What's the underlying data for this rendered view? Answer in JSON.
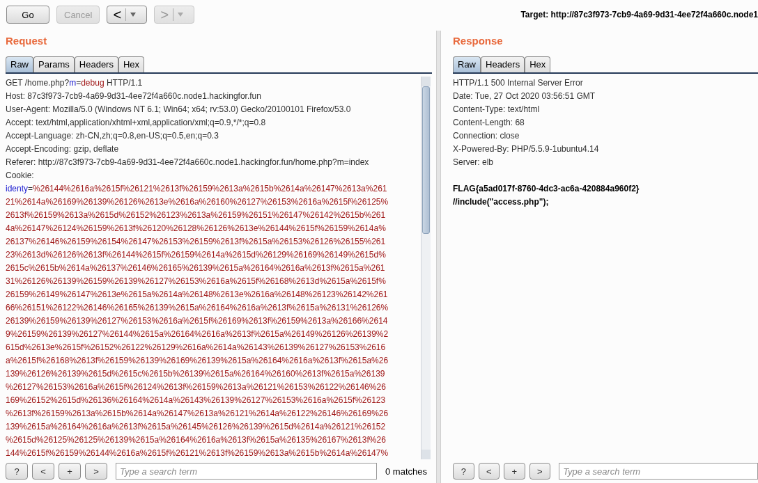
{
  "toolbar": {
    "buttons": [
      {
        "label": "Go",
        "disabled": false
      },
      {
        "label": "Cancel",
        "disabled": true
      }
    ],
    "nav": [
      {
        "label": "<",
        "disabled": false
      },
      {
        "label": ">",
        "disabled": true
      }
    ],
    "target": "Target: http://87c3f973-7cb9-4a69-9d31-4ee72f4a660c.node1"
  },
  "request": {
    "title": "Request",
    "tabs": [
      {
        "label": "Raw",
        "selected": true
      },
      {
        "label": "Params",
        "selected": false
      },
      {
        "label": "Headers",
        "selected": false
      },
      {
        "label": "Hex",
        "selected": false
      }
    ],
    "lines": [
      [
        {
          "text": "GET /home.php?",
          "kind": "plain"
        },
        {
          "text": "m",
          "kind": "key"
        },
        {
          "text": "=",
          "kind": "plain"
        },
        {
          "text": "debug",
          "kind": "value"
        },
        {
          "text": " HTTP/1.1",
          "kind": "plain"
        }
      ],
      [
        {
          "text": "Host: 87c3f973-7cb9-4a69-9d31-4ee72f4a660c.node1.hackingfor.fun",
          "kind": "plain"
        }
      ],
      [
        {
          "text": "User-Agent: Mozilla/5.0 (Windows NT 6.1; Win64; x64; rv:53.0) Gecko/20100101 Firefox/53.0",
          "kind": "plain"
        }
      ],
      [
        {
          "text": "Accept: text/html,application/xhtml+xml,application/xml;q=0.9,*/*;q=0.8",
          "kind": "plain"
        }
      ],
      [
        {
          "text": "Accept-Language: zh-CN,zh;q=0.8,en-US;q=0.5,en;q=0.3",
          "kind": "plain"
        }
      ],
      [
        {
          "text": "Accept-Encoding: gzip, deflate",
          "kind": "plain"
        }
      ],
      [
        {
          "text": "Referer: http://87c3f973-7cb9-4a69-9d31-4ee72f4a660c.node1.hackingfor.fun/home.php?m=index",
          "kind": "plain"
        }
      ],
      [
        {
          "text": "Cookie:",
          "kind": "plain"
        }
      ],
      [
        {
          "text": "identy",
          "kind": "key"
        },
        {
          "text": "=",
          "kind": "plain"
        },
        {
          "text": "%26144%2616a%2615f%26121%2613f%26159%2613a%2615b%2614a%26147%2613a%261",
          "kind": "value"
        }
      ],
      [
        {
          "text": "21%2614a%26169%26139%26126%2613e%2616a%26160%26127%26153%2616a%2615f%26125%",
          "kind": "value"
        }
      ],
      [
        {
          "text": "2613f%26159%2613a%2615d%26152%26123%2613a%26159%26151%26147%26142%2615b%261",
          "kind": "value"
        }
      ],
      [
        {
          "text": "4a%26147%26124%26159%2613f%26120%26128%26126%2613e%26144%2615f%26159%2614a%",
          "kind": "value"
        }
      ],
      [
        {
          "text": "26137%26146%26159%26154%26147%26153%26159%2613f%2615a%26153%26126%26155%261",
          "kind": "value"
        }
      ],
      [
        {
          "text": "23%2613d%26126%2613f%26144%2615f%26159%2614a%2615d%26129%26169%26149%2615d%",
          "kind": "value"
        }
      ],
      [
        {
          "text": "2615c%2615b%2614a%26137%26146%26165%26139%2615a%26164%2616a%2613f%2615a%261",
          "kind": "value"
        }
      ],
      [
        {
          "text": "31%26126%26139%26159%26139%26127%26153%2616a%2615f%26168%2613d%2615a%2615f%",
          "kind": "value"
        }
      ],
      [
        {
          "text": "26159%26149%26147%2613e%2615a%2614a%26148%2613e%2616a%26148%26123%26142%261",
          "kind": "value"
        }
      ],
      [
        {
          "text": "66%26151%26122%26146%26165%26139%2615a%26164%2616a%2613f%2615a%26131%26126%",
          "kind": "value"
        }
      ],
      [
        {
          "text": "26139%26159%26139%26127%26153%2616a%2615f%26169%2613f%26159%2613a%26166%2614",
          "kind": "value"
        }
      ],
      [
        {
          "text": "9%26159%26139%26127%26144%2615a%26164%2616a%2613f%2615a%26149%26126%26139%2",
          "kind": "value"
        }
      ],
      [
        {
          "text": "615d%2613e%2615f%26152%26122%26129%2616a%2614a%26143%26139%26127%26153%2616",
          "kind": "value"
        }
      ],
      [
        {
          "text": "a%2615f%26168%2613f%26159%26139%26169%26139%2615a%26164%2616a%2613f%2615a%26",
          "kind": "value"
        }
      ],
      [
        {
          "text": "139%26126%26139%2615d%2615c%2615b%26139%2615a%26164%26160%2613f%2615a%26139",
          "kind": "value"
        }
      ],
      [
        {
          "text": "%26127%26153%2616a%2615f%26124%2613f%26159%2613a%26121%26153%26122%26146%26",
          "kind": "value"
        }
      ],
      [
        {
          "text": "169%26152%2615d%26136%26164%2614a%26143%26139%26127%26153%2616a%2615f%26123",
          "kind": "value"
        }
      ],
      [
        {
          "text": "%2613f%26159%2613a%2615b%2614a%26147%2613a%26121%2614a%26122%26146%26169%26",
          "kind": "value"
        }
      ],
      [
        {
          "text": "139%2615a%26164%2616a%2613f%2615a%26145%26126%26139%2615d%2614a%26121%26152",
          "kind": "value"
        }
      ],
      [
        {
          "text": "%2615d%26125%26125%26139%2615a%26164%2616a%2613f%2615a%26135%26167%2613f%26",
          "kind": "value"
        }
      ],
      [
        {
          "text": "144%2615f%26159%26144%2616a%2615f%26121%2613f%26159%2613a%2615b%2614a%26147%",
          "kind": "value"
        }
      ]
    ],
    "search": {
      "buttons": [
        "?",
        "<",
        "+",
        ">"
      ],
      "placeholder": "Type a search term",
      "matches": "0 matches"
    }
  },
  "response": {
    "title": "Response",
    "tabs": [
      {
        "label": "Raw",
        "selected": true
      },
      {
        "label": "Headers",
        "selected": false
      },
      {
        "label": "Hex",
        "selected": false
      }
    ],
    "headers": [
      "HTTP/1.1 500 Internal Server Error",
      "Date: Tue, 27 Oct 2020 03:56:51 GMT",
      "Content-Type: text/html",
      "Content-Length: 68",
      "Connection: close",
      "X-Powered-By: PHP/5.5.9-1ubuntu4.14",
      "Server: elb"
    ],
    "body": [
      "FLAG{a5ad017f-8760-4dc3-ac6a-420884a960f2}",
      "//include(\"access.php\");"
    ],
    "search": {
      "buttons": [
        "?",
        "<",
        "+",
        ">"
      ],
      "placeholder": "Type a search term"
    }
  }
}
